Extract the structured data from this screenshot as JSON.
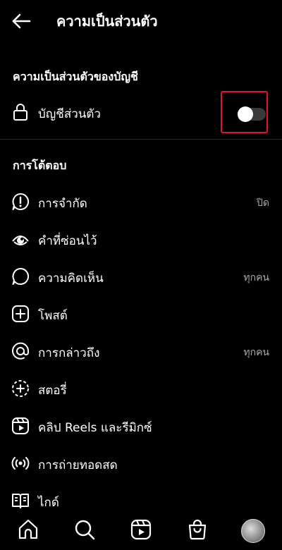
{
  "header": {
    "title": "ความเป็นส่วนตัว",
    "back_icon": "arrow-left-icon"
  },
  "account_privacy": {
    "section_title": "ความเป็นส่วนตัวของบัญชี",
    "private_account_label": "บัญชีส่วนตัว",
    "private_account_icon": "lock-icon",
    "private_account_enabled": false,
    "highlight_color": "#e0152a"
  },
  "interactions": {
    "section_title": "การโต้ตอบ",
    "items": [
      {
        "label": "การจำกัด",
        "value": "ปิด",
        "icon": "restrict-icon"
      },
      {
        "label": "คำที่ซ่อนไว้",
        "value": "",
        "icon": "hidden-words-icon"
      },
      {
        "label": "ความคิดเห็น",
        "value": "ทุกคน",
        "icon": "comment-icon"
      },
      {
        "label": "โพสต์",
        "value": "",
        "icon": "add-post-icon"
      },
      {
        "label": "การกล่าวถึง",
        "value": "ทุกคน",
        "icon": "mention-icon"
      },
      {
        "label": "สตอรี่",
        "value": "",
        "icon": "story-icon"
      },
      {
        "label": "คลิป Reels และรีมิกซ์",
        "value": "",
        "icon": "reels-icon"
      },
      {
        "label": "การถ่ายทอดสด",
        "value": "",
        "icon": "live-icon"
      },
      {
        "label": "ไกด์",
        "value": "",
        "icon": "guide-icon"
      }
    ]
  },
  "bottom_nav": {
    "items": [
      "home-icon",
      "search-icon",
      "reels-icon",
      "shop-icon",
      "profile-avatar"
    ]
  }
}
